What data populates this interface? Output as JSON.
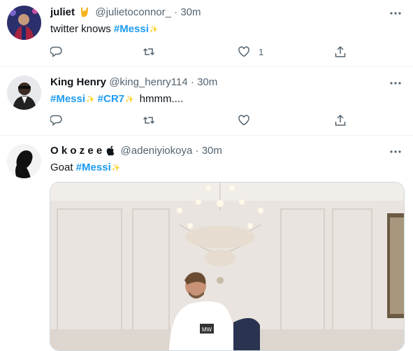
{
  "tweets": [
    {
      "name": "juliet",
      "handle": "@julietoconnor_",
      "sep": "·",
      "time": "30m",
      "text_prefix": "twitter knows",
      "hashtags": [
        "#Messi"
      ],
      "text_suffix": "",
      "actions": {
        "reply": "",
        "retweet": "",
        "like": "1",
        "share": ""
      }
    },
    {
      "name": "King Henry",
      "handle": "@king_henry114",
      "sep": "·",
      "time": "30m",
      "text_prefix": "",
      "hashtags": [
        "#Messi",
        "#CR7"
      ],
      "text_suffix": "hmmm....",
      "actions": {
        "reply": "",
        "retweet": "",
        "like": "",
        "share": ""
      }
    },
    {
      "name": "O k o z e e",
      "handle": "@adeniyiokoya",
      "sep": "·",
      "time": "30m",
      "text_prefix": "Goat",
      "hashtags": [
        "#Messi"
      ],
      "text_suffix": "",
      "has_image": true
    }
  ],
  "image_text": "MW"
}
